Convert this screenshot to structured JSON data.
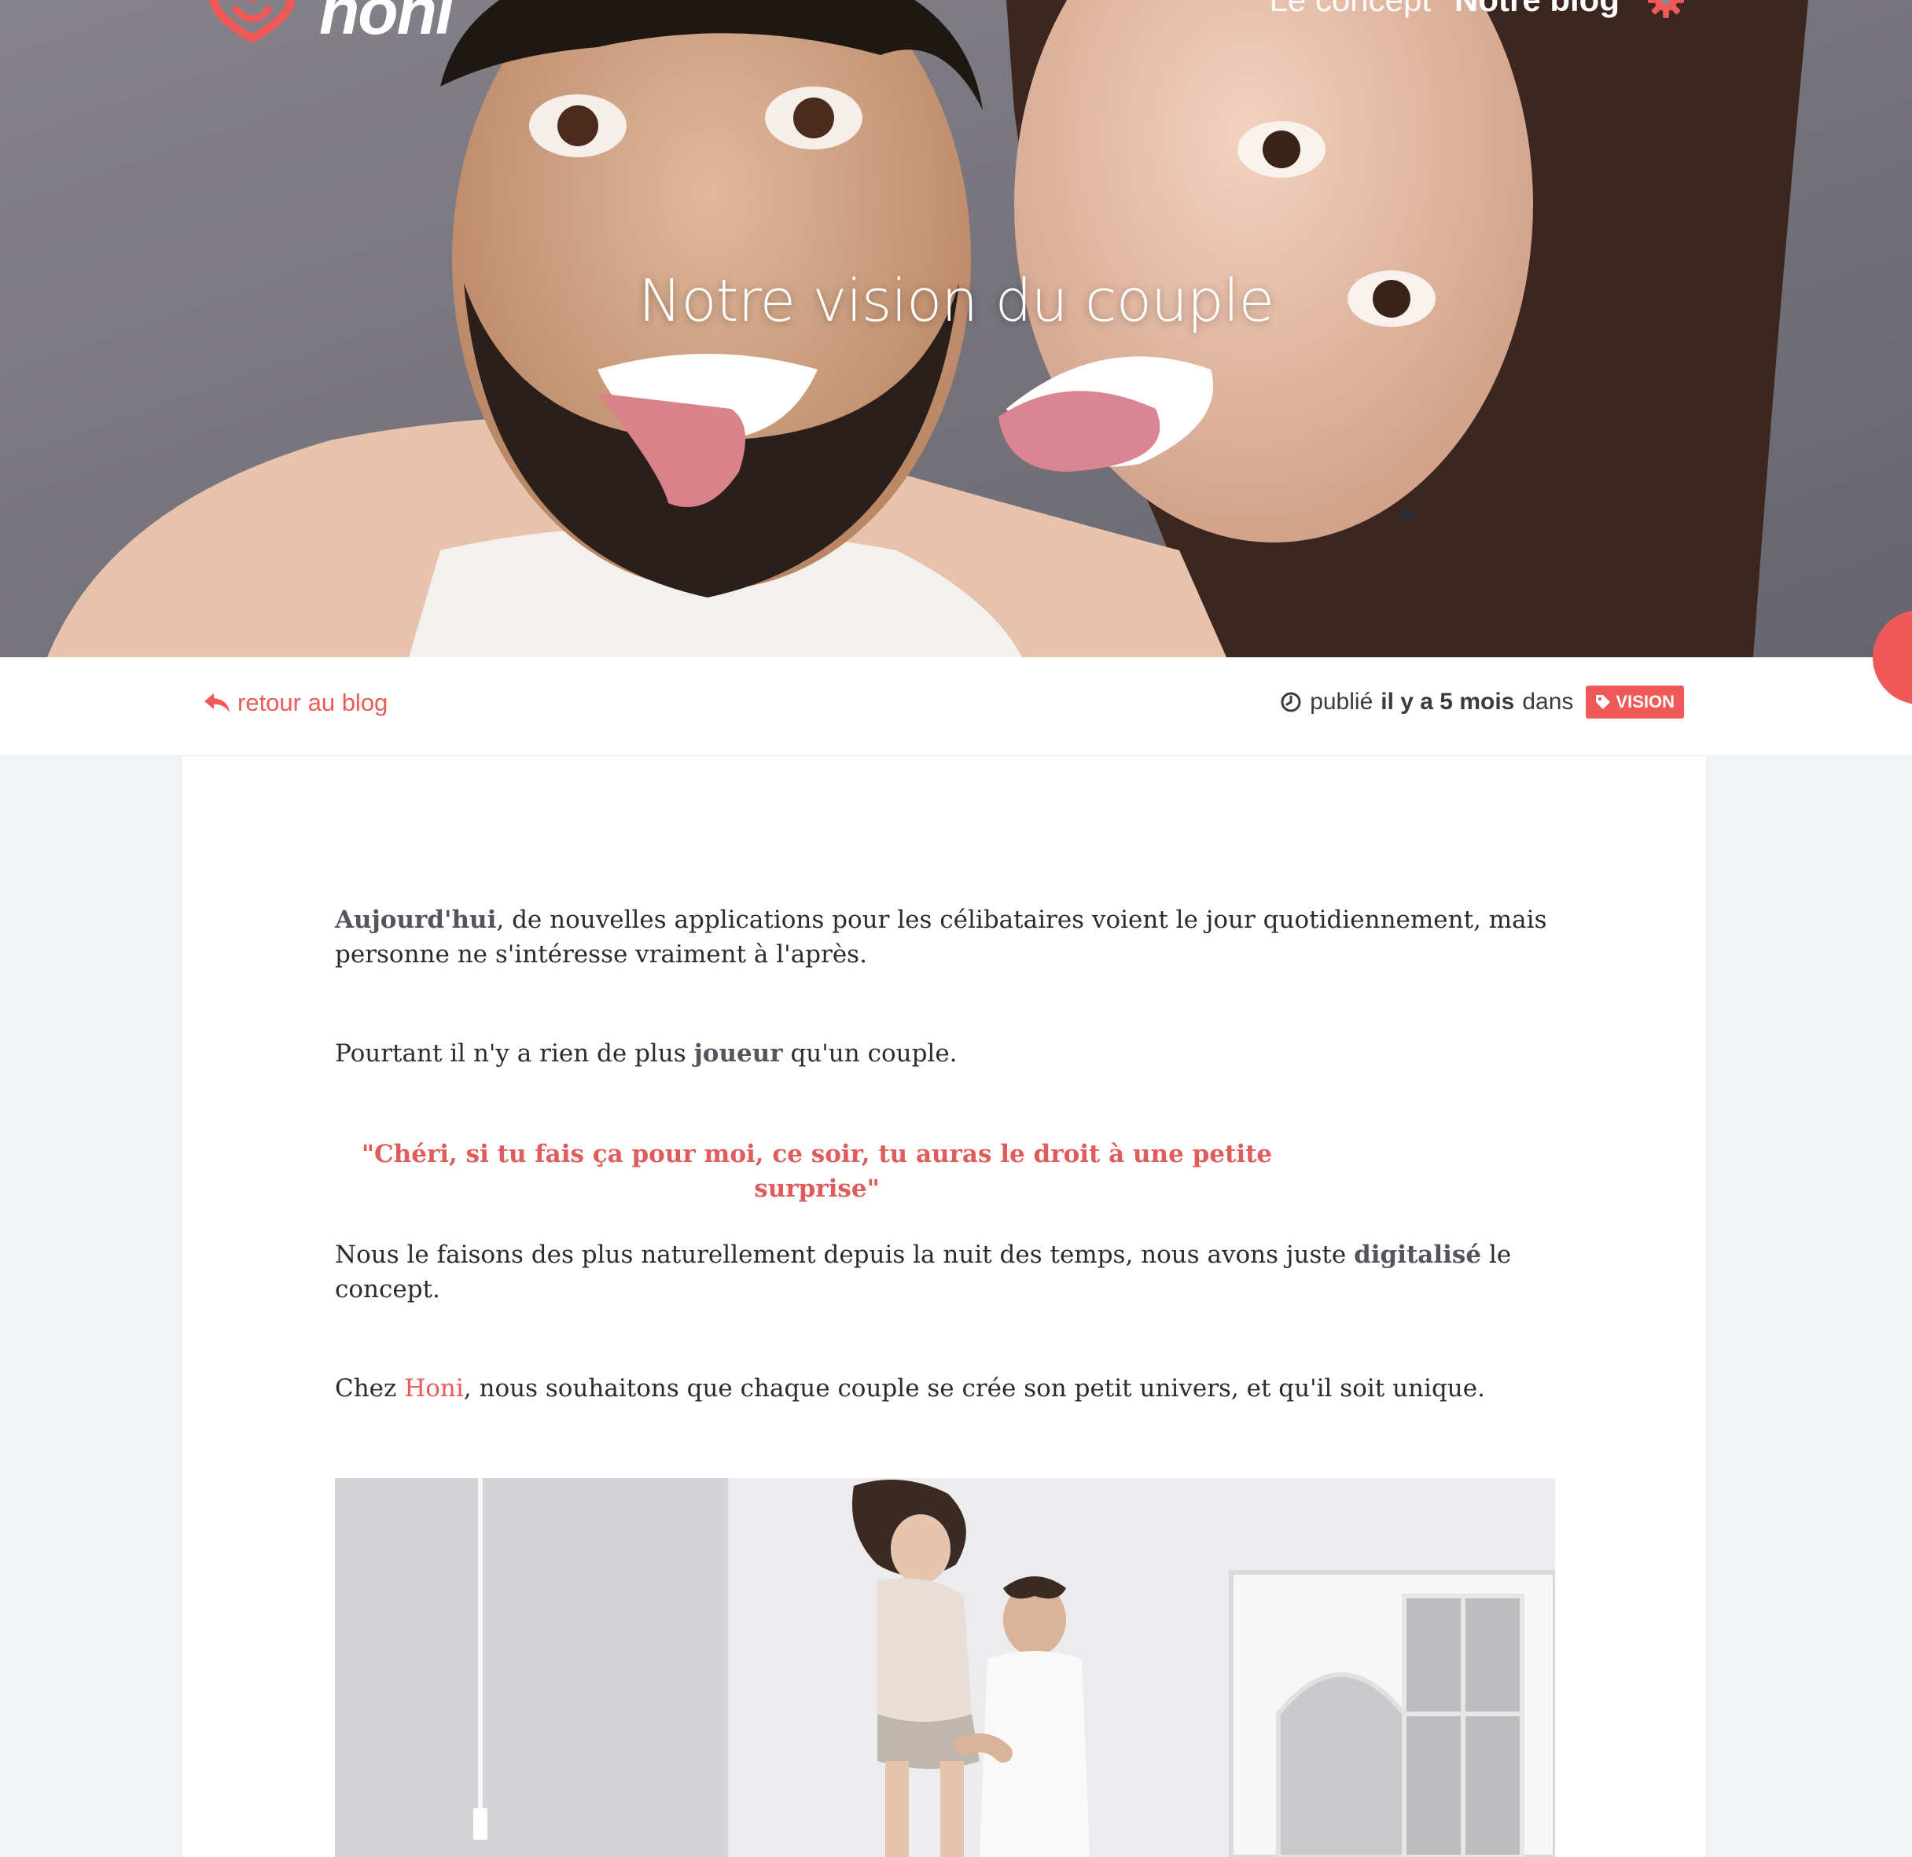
{
  "header": {
    "logo_text": "honi",
    "nav": {
      "concept_label": "Le concept",
      "blog_label": "Notre blog"
    },
    "hero_title": "Notre vision du couple"
  },
  "meta": {
    "back_label": "retour au blog",
    "published_prefix": "publié",
    "published_time": "il y a 5 mois",
    "published_suffix": "dans",
    "tag_label": "VISION"
  },
  "article": {
    "p1_strong": "Aujourd'hui",
    "p1_rest": ", de nouvelles applications pour les célibataires voient le jour quotidiennement, mais personne ne s'intéresse vraiment à l'après.",
    "p2_before": "Pourtant il n'y a rien de plus ",
    "p2_strong": "joueur",
    "p2_after": " qu'un couple.",
    "quote": "\"Chéri, si tu fais ça pour moi, ce soir, tu auras le droit à une petite surprise\"",
    "p3_before": "Nous le faisons des plus naturellement depuis la nuit des temps,  nous avons juste ",
    "p3_strong": "digitalisé",
    "p3_after": " le concept.",
    "p4_before": "Chez ",
    "p4_link": "Honi",
    "p4_after": ",  nous souhaitons que chaque couple se crée son petit univers, et qu'il soit unique."
  },
  "colors": {
    "accent": "#ef5a58",
    "quote": "#e05b5b",
    "page_bg": "#f2f3f5"
  },
  "icons": {
    "logo": "honi-heart-logo-icon",
    "settings": "gear-icon",
    "back": "reply-arrow-icon",
    "time": "clock-icon",
    "tag": "tag-icon"
  }
}
